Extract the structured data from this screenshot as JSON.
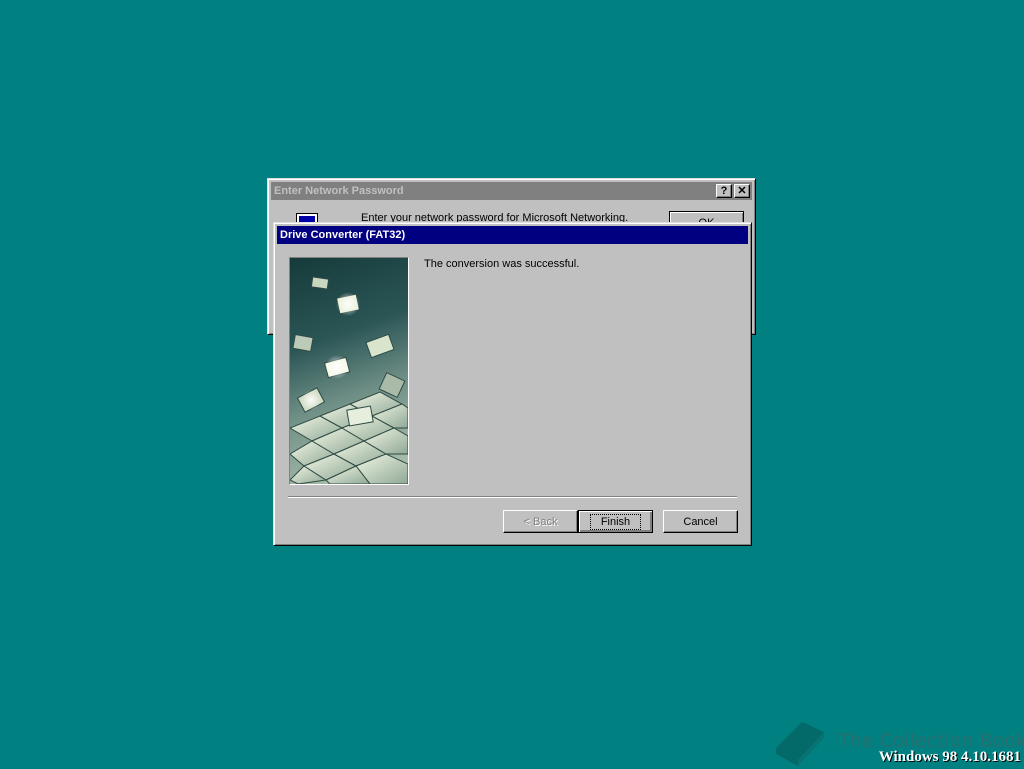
{
  "desktop": {
    "background_color": "#008080",
    "watermark_text": "The Collection Book",
    "version_text": "Windows 98 4.10.1681"
  },
  "password_window": {
    "title": "Enter Network Password",
    "help_button": "?",
    "close_button": "✕",
    "message": "Enter your network password for Microsoft Networking.",
    "ok_label": "OK",
    "icon": "network-computer-icon"
  },
  "converter_window": {
    "title": "Drive Converter (FAT32)",
    "message": "The conversion was successful.",
    "image": "wizard-tiles-graphic",
    "buttons": {
      "back": "< Back",
      "finish": "Finish",
      "cancel": "Cancel"
    }
  }
}
